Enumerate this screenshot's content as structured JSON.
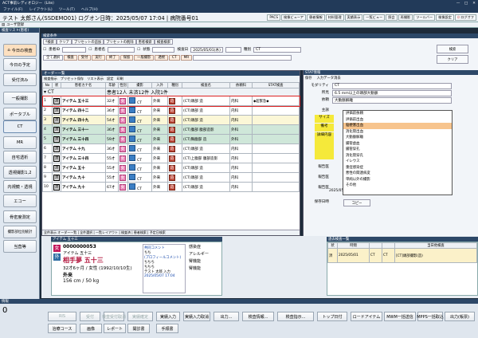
{
  "window": {
    "title": "ACT事前レディオロジー（Lite）"
  },
  "menu": [
    "ファイル(F)",
    "レイアウト(L)",
    "ツール(T)",
    "ヘルプ(H)"
  ],
  "header": {
    "user": "テスト 太郎さん(SSDEMO01) ログオン日時：2025/05/07 17:04 | 病院番号01",
    "buttons": [
      "PACS",
      "検像ビューア",
      "患者情報",
      "材料管理",
      "実績表示",
      "一覧ビュー",
      "照会",
      "再撮影",
      "ツールバー",
      "検像設定",
      "ログオフ"
    ],
    "logoff": "ログオフ"
  },
  "subbar": {
    "label": "ユーザ登録"
  },
  "left": {
    "panel_title": "検査リスト(患者)",
    "buttons": [
      "今日の検査",
      "今日の予定",
      "受付済み",
      "一般撮影",
      "ポータブル",
      "CT",
      "MR",
      "自宅透析",
      "透視撮影1,2",
      "内視鏡・透視",
      "エコー",
      "骨密度測定",
      "撮影部位別統計",
      "当直等"
    ],
    "active": "CT"
  },
  "filter": {
    "title": "検索条件",
    "toolbar": [
      "検索",
      "クリア",
      "プリセットの追加",
      "プリセットの削除",
      "患者検索",
      "検査検索"
    ],
    "checks": [
      "患者ID",
      "患者名",
      "状態"
    ],
    "date_label": "検査日",
    "date_value": "2025/05/01(木)",
    "modality_label": "種別",
    "modality_value": "CT",
    "categories": [
      "全て選択",
      "検査",
      "受付",
      "実行",
      "終了",
      "保留",
      "一般撮影",
      "透視",
      "CT",
      "MR"
    ],
    "search_button": "検索",
    "clear_button": "クリア"
  },
  "list": {
    "title": "オーダー一覧",
    "tools": [
      "検査指示",
      "プリセット保存",
      "リスト表示",
      "設定",
      "印刷"
    ],
    "group_label": "CT",
    "summary": "患者12人 未済12件 入院1件",
    "columns": [
      "No",
      "状",
      "患者カナ名",
      "年齢",
      "性別",
      "撮影",
      "入外",
      "種別",
      "検査名",
      "依頼科",
      "STAT検査"
    ],
    "rows": [
      {
        "no": "1",
        "st": "済",
        "name": "アイテム 五十三",
        "age": "32才",
        "sex": "女",
        "mod": "CT",
        "io": "外来",
        "kind": "造",
        "exam": "(CT)頭部 造",
        "dept": "内科",
        "stat": "◆超緊急◆",
        "color": "sel"
      },
      {
        "no": "2",
        "st": "済",
        "name": "アイテム 四十二",
        "age": "36才",
        "sex": "女",
        "mod": "CT",
        "io": "外来",
        "kind": "造",
        "exam": "(CT)頭部 造",
        "dept": "内科",
        "stat": "",
        "color": "white"
      },
      {
        "no": "3",
        "st": "済",
        "name": "アイテム 四十九",
        "age": "54才",
        "sex": "女",
        "mod": "CT",
        "io": "外来",
        "kind": "造",
        "exam": "(CT)頭部 造",
        "dept": "内科",
        "stat": "",
        "color": "yellow"
      },
      {
        "no": "4",
        "st": "済",
        "name": "アイテム 三十一",
        "age": "36才",
        "sex": "女",
        "mod": "CT",
        "io": "外来",
        "kind": "造",
        "exam": "(CT)腹部 腹部造影",
        "dept": "外科",
        "stat": "",
        "color": "green"
      },
      {
        "no": "5",
        "st": "済",
        "name": "アイテム 三十四",
        "age": "59才",
        "sex": "女",
        "mod": "CT",
        "io": "外来",
        "kind": "造",
        "exam": "(CT)胸腹部 造",
        "dept": "外科",
        "stat": "",
        "color": "green"
      },
      {
        "no": "6",
        "st": "済",
        "name": "アイテム 十九",
        "age": "36才",
        "sex": "女",
        "mod": "CT",
        "io": "外来",
        "kind": "造",
        "exam": "(CT)頭部 造",
        "dept": "内科",
        "stat": "",
        "color": "white"
      },
      {
        "no": "7",
        "st": "済",
        "name": "アイテム 三十四",
        "age": "55才",
        "sex": "女",
        "mod": "CT",
        "io": "外来",
        "kind": "造",
        "exam": "(CT)上腹部 腹部造影",
        "dept": "内科",
        "stat": "",
        "color": "white"
      },
      {
        "no": "8",
        "st": "済",
        "name": "アイテム 五十",
        "age": "55才",
        "sex": "女",
        "mod": "CT",
        "io": "外来",
        "kind": "造",
        "exam": "(CT)頭部 造",
        "dept": "内科",
        "stat": "",
        "color": "white"
      },
      {
        "no": "9",
        "st": "済",
        "name": "アイテム 九十",
        "age": "55才",
        "sex": "女",
        "mod": "CT",
        "io": "外来",
        "kind": "造",
        "exam": "(CT)頭部 造",
        "dept": "内科",
        "stat": "",
        "color": "white"
      },
      {
        "no": "10",
        "st": "済",
        "name": "アイテム 九十",
        "age": "67才",
        "sex": "女",
        "mod": "CT",
        "io": "外来",
        "kind": "造",
        "exam": "(CT)頭部 造",
        "dept": "内科",
        "stat": "",
        "color": "white"
      }
    ],
    "footer": "全件表示 オーダー一覧 | 全件選択 | 一覧レイアウト | 検査済 | 患者検索 | 予定日検索"
  },
  "stat_panel": {
    "title": "STAT情報",
    "tools": [
      "保存",
      "入力データ消去"
    ],
    "labels": [
      "モダリティ",
      "所見",
      "依頼",
      "主訴",
      "サイズ",
      "備考",
      "詳細内容",
      "報告医",
      "報告医",
      "報告医",
      "保存日時"
    ],
    "modality": "CT",
    "finding": "6.5 mm以上の頭部大動脈",
    "request": "大動脈解離",
    "save_time": "2025/05/07 15:54:39",
    "copy_button": "コピー",
    "dropdown": [
      "評価前依頼",
      "評価前出血",
      "脳梗塞出血",
      "消化管出血",
      "大動脈解離",
      "腸管虚血",
      "腸管穿孔",
      "消化管穿孔",
      "イレウス",
      "重症感染症",
      "悪性の関連病変",
      "単純以外の撮影",
      "その他"
    ],
    "dropdown_hl": "脳梗塞出血"
  },
  "patient": {
    "id": "0000000053",
    "kana": "アイテム 五十三",
    "name": "相手夢 五十三",
    "age_sex": "32才6ヶ月 / 女性 (1992/10/10生)",
    "io": "外来",
    "body": "156 cm / 50 kg",
    "comment_title": "共同コメント",
    "comments": [
      "ちち",
      "(プロフィールコメント)",
      "ちちち",
      "ちちち",
      "テスト 太郎 入力",
      "2025/05/07 17:04"
    ],
    "info_labels": [
      "感染症",
      "アレルギー",
      "腎機能",
      "腎機能"
    ]
  },
  "history": {
    "title": "過去検査一覧",
    "columns": [
      "状",
      "時間",
      "",
      "",
      "当日他検査"
    ],
    "rows": [
      {
        "st": "済",
        "date": "2025/05/01",
        "mod": "CT",
        "type": "CT",
        "exam": "[CT]頭部撮影(造)"
      }
    ]
  },
  "bottom": {
    "panel_label": "情報",
    "count": "0",
    "row1": [
      "RIS",
      "受付",
      "検査受付取消",
      "実績確定",
      "実績入力",
      "実績入力取消",
      "出力...",
      "検査情報...",
      "検査指示...",
      "トップ日付",
      "ロードアイテム",
      "MWM一括送信",
      "MPPS一括取込",
      "出力(帳票)"
    ],
    "row2": [
      "治療コース",
      "画像",
      "レポート",
      "開診書",
      "手順書"
    ]
  }
}
